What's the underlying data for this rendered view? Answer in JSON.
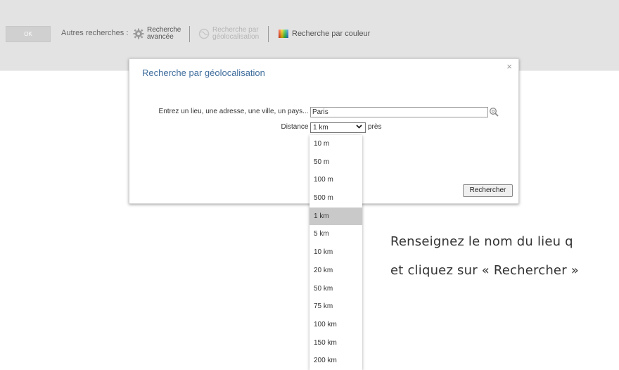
{
  "toolbar": {
    "ok_label": "OK",
    "other_searches_label": "Autres recherches :",
    "advanced": {
      "line1": "Recherche",
      "line2": "avancée",
      "icon": "gear-icon"
    },
    "geolocation": {
      "line1": "Recherche par",
      "line2": "géolocalisation",
      "icon": "globe-icon"
    },
    "color": {
      "label": "Recherche par couleur",
      "icon": "color-palette-icon"
    }
  },
  "modal": {
    "title": "Recherche par géolocalisation",
    "close": "×",
    "place_label": "Entrez un lieu, une adresse, une ville, un pays... :",
    "place_value": "Paris",
    "distance_label": "Distance :",
    "distance_value": "1 km",
    "pres_label": "près",
    "search_button": "Rechercher"
  },
  "distance_options": [
    "10 m",
    "50 m",
    "100 m",
    "500 m",
    "1 km",
    "5 km",
    "10 km",
    "20 km",
    "50 km",
    "75 km",
    "100 km",
    "150 km",
    "200 km"
  ],
  "selected_option_index": 4,
  "instructions": {
    "line1": "Renseignez le nom du lieu q",
    "line2": "et cliquez sur « Rechercher »"
  }
}
